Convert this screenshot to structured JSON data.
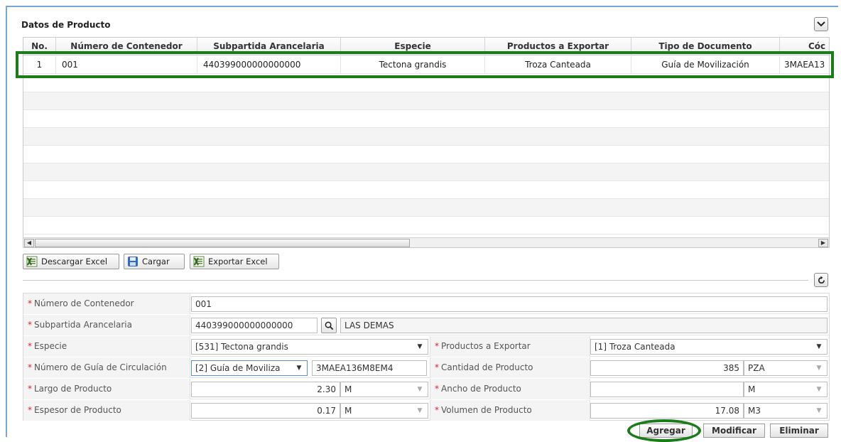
{
  "panel": {
    "title": "Datos de Producto"
  },
  "grid": {
    "columns": [
      "No.",
      "Número de Contenedor",
      "Subpartida Arancelaria",
      "Especie",
      "Productos a Exportar",
      "Tipo de Documento",
      "Cóc"
    ],
    "rows": [
      [
        "1",
        "001",
        "440399000000000000",
        "Tectona grandis",
        "Troza Canteada",
        "Guía de Movilización",
        "3MAEA13"
      ]
    ]
  },
  "toolbar": {
    "download_excel": "Descargar Excel",
    "load": "Cargar",
    "export_excel": "Exportar Excel"
  },
  "form": {
    "contenedor": {
      "label": "Número de Contenedor",
      "value": "001"
    },
    "subpartida": {
      "label": "Subpartida Arancelaria",
      "value": "440399000000000000",
      "description": "LAS DEMAS"
    },
    "especie": {
      "label": "Especie",
      "value": "[531] Tectona grandis"
    },
    "productos": {
      "label": "Productos a Exportar",
      "value": "[1] Troza Canteada"
    },
    "guia": {
      "label": "Número de Guía de Circulación",
      "type_value": "[2] Guía de Moviliza",
      "number": "3MAEA136M8EM4"
    },
    "cantidad": {
      "label": "Cantidad de Producto",
      "value": "385",
      "unit": "PZA"
    },
    "largo": {
      "label": "Largo de Producto",
      "value": "2.30",
      "unit": "M"
    },
    "ancho": {
      "label": "Ancho de Producto",
      "value": "",
      "unit": "M"
    },
    "espesor": {
      "label": "Espesor de Producto",
      "value": "0.17",
      "unit": "M"
    },
    "volumen": {
      "label": "Volumen de Producto",
      "value": "17.08",
      "unit": "M3"
    },
    "required_mark": "*"
  },
  "actions": {
    "add": "Agregar",
    "modify": "Modificar",
    "delete": "Eliminar"
  },
  "colors": {
    "highlight": "#1a7d1a",
    "frame": "#7aa6d6",
    "required": "#d22222"
  }
}
